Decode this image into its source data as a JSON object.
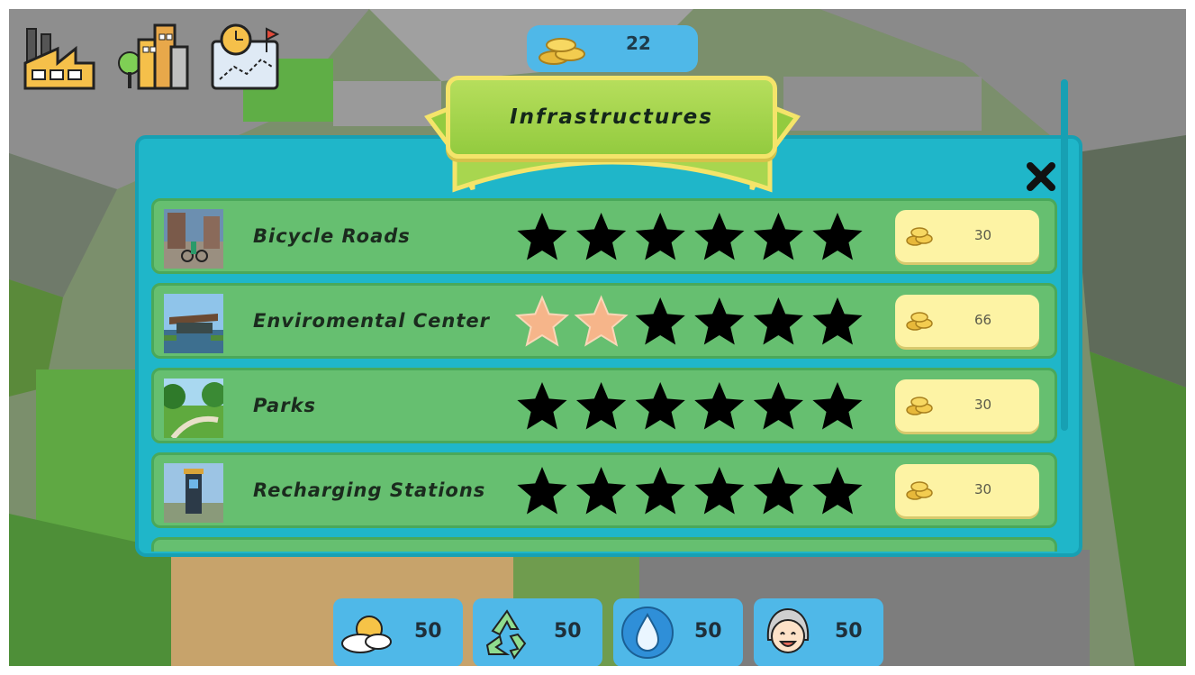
{
  "top_icons": [
    {
      "name": "factory-icon"
    },
    {
      "name": "city-buildings-icon"
    },
    {
      "name": "planning-map-icon"
    }
  ],
  "coin_counter": {
    "value": "22"
  },
  "modal": {
    "title": "Infrastructures",
    "close_icon": "close-icon",
    "rows": [
      {
        "name": "Bicycle Roads",
        "stars_filled": 0,
        "stars_total": 6,
        "price": "30",
        "thumb": "bicycle-roads-thumb"
      },
      {
        "name": "Enviromental Center",
        "stars_filled": 2,
        "stars_total": 6,
        "price": "66",
        "thumb": "environmental-center-thumb"
      },
      {
        "name": "Parks",
        "stars_filled": 0,
        "stars_total": 6,
        "price": "30",
        "thumb": "parks-thumb"
      },
      {
        "name": "Recharging Stations",
        "stars_filled": 0,
        "stars_total": 6,
        "price": "30",
        "thumb": "recharging-stations-thumb"
      }
    ]
  },
  "stats": [
    {
      "icon": "weather-icon",
      "value": "50"
    },
    {
      "icon": "recycle-icon",
      "value": "50"
    },
    {
      "icon": "water-drop-icon",
      "value": "50"
    },
    {
      "icon": "happiness-face-icon",
      "value": "50"
    }
  ],
  "colors": {
    "panel": "#1fb6c9",
    "row": "#66bf70",
    "banner": "#a8d64f",
    "price_bg": "#fdf3a4",
    "star_filled": "#f6b58a",
    "star_empty": "#000000",
    "stat_bg": "#4fb8e8"
  }
}
